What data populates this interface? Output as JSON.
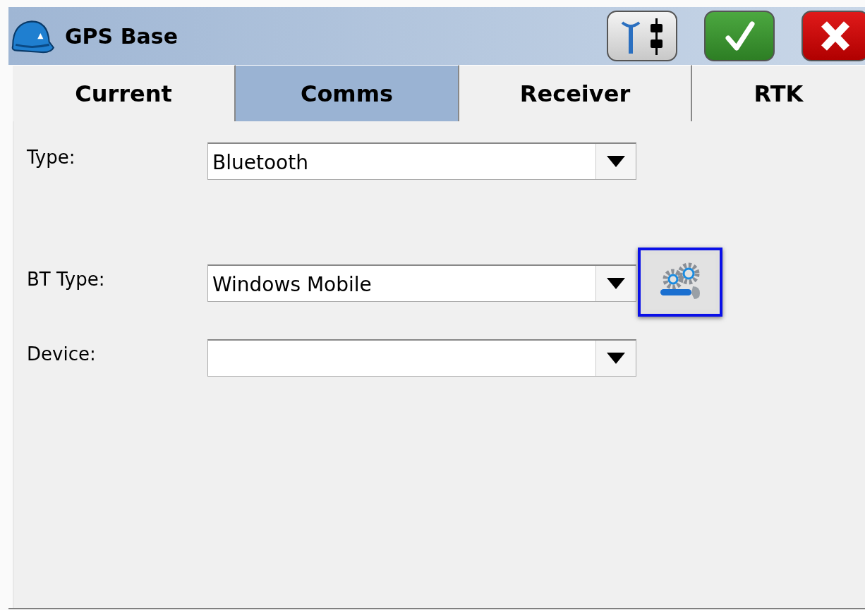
{
  "window": {
    "title": "GPS Base"
  },
  "toolbar": [
    {
      "kind": "antenna"
    },
    {
      "kind": "ok"
    },
    {
      "kind": "cancel"
    }
  ],
  "tabs": [
    {
      "label": "Current",
      "selected": false
    },
    {
      "label": "Comms",
      "selected": true
    },
    {
      "label": "Receiver",
      "selected": false
    },
    {
      "label": "RTK",
      "selected": false
    }
  ],
  "fields": [
    {
      "label": "Type:",
      "value": "Bluetooth"
    },
    {
      "label": "BT Type:",
      "value": "Windows Mobile",
      "settings_button": {
        "focused": true
      }
    },
    {
      "label": "Device:"
    }
  ]
}
